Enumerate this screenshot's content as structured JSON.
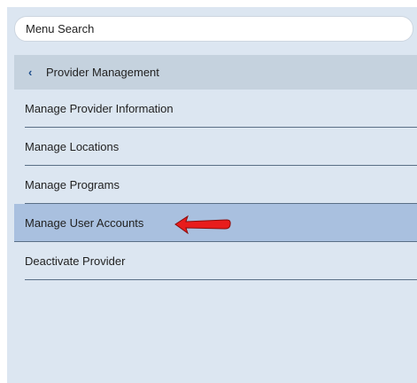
{
  "search": {
    "placeholder": "Menu Search"
  },
  "section": {
    "title": "Provider Management",
    "back_icon": "chevron-left-icon"
  },
  "menu": {
    "items": [
      {
        "label": "Manage Provider Information",
        "active": false
      },
      {
        "label": "Manage Locations",
        "active": false
      },
      {
        "label": "Manage Programs",
        "active": false
      },
      {
        "label": "Manage User Accounts",
        "active": true
      },
      {
        "label": "Deactivate Provider",
        "active": false
      }
    ]
  },
  "annotation": {
    "icon": "red-arrow-icon",
    "color": "#e81c1c"
  },
  "colors": {
    "panel_bg": "#dce6f1",
    "header_bg": "#c5d2de",
    "active_bg": "#a9c0df",
    "divider": "#5a6f86",
    "chevron": "#1f4e8c"
  }
}
